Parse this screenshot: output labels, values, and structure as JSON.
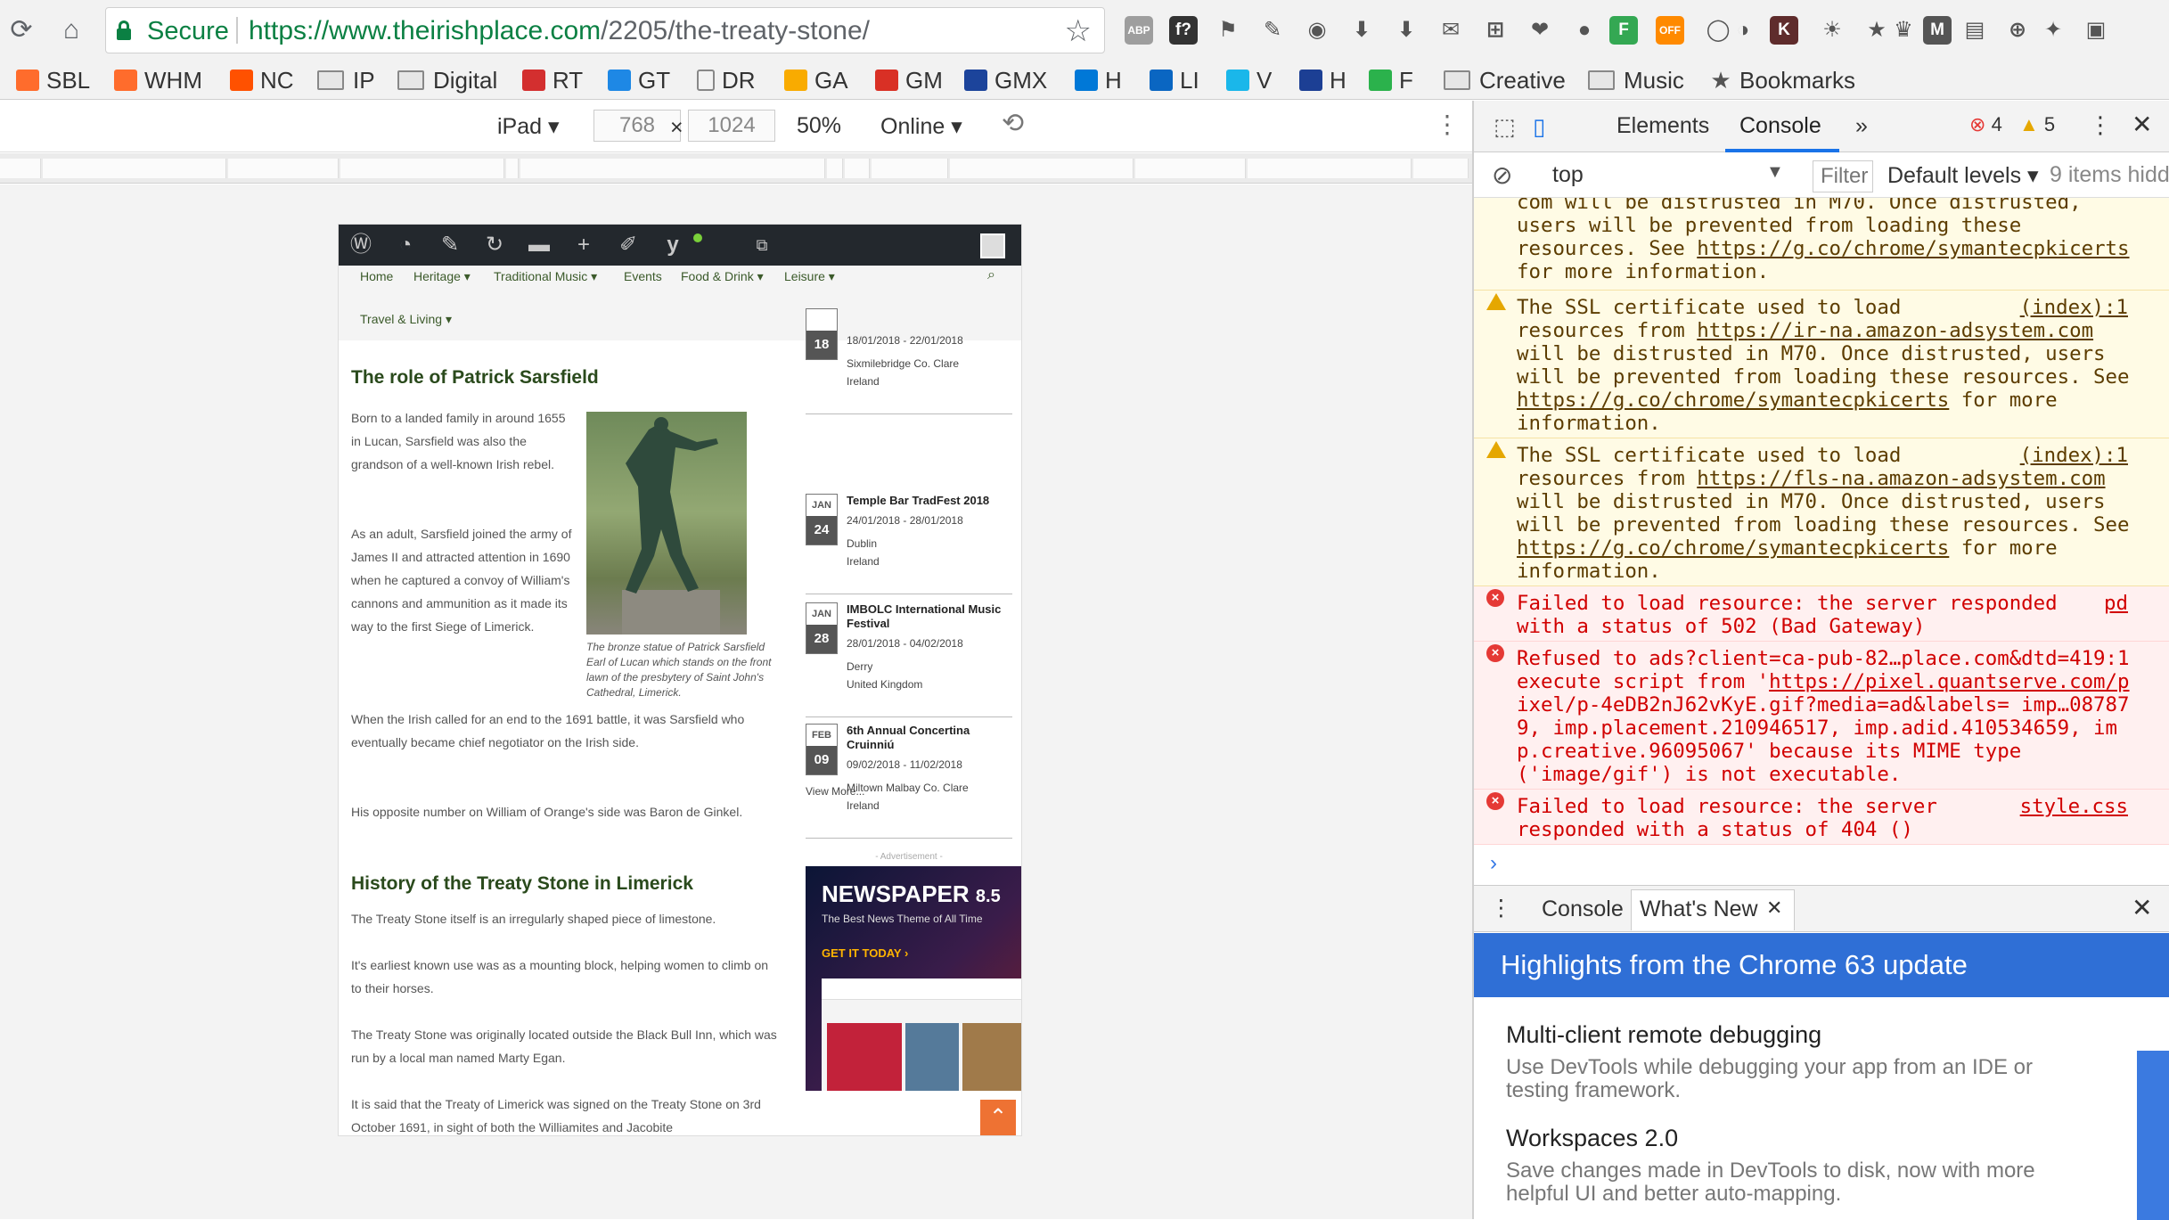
{
  "browser": {
    "secure_label": "Secure",
    "url_domain": "https://www.theirishplace.com",
    "url_path": "/2205/the-treaty-stone/",
    "extensions": [
      {
        "label": "ABP",
        "color": "#9e9e9e"
      },
      {
        "label": "f?",
        "color": "#333333"
      },
      {
        "label": "F",
        "color": "#34a853"
      },
      {
        "label": "OFF",
        "color": "#ff8a00"
      },
      {
        "label": "K",
        "color": "#5f2c2c"
      },
      {
        "label": "M",
        "color": "#555555"
      }
    ]
  },
  "bookmarks": [
    {
      "label": "SBL",
      "icon": "cpanel-icon",
      "color": "#ff6c2c"
    },
    {
      "label": "WHM",
      "icon": "cpanel-icon",
      "color": "#ff6c2c"
    },
    {
      "label": "NC",
      "icon": "namecheap-icon",
      "color": "#ff5100"
    },
    {
      "label": "IP",
      "icon": "folder-icon",
      "color": "#888888"
    },
    {
      "label": "Digital",
      "icon": "folder-icon",
      "color": "#888888"
    },
    {
      "label": "RT",
      "icon": "robot-icon",
      "color": "#d32f2f"
    },
    {
      "label": "GT",
      "icon": "chart-icon",
      "color": "#1e88e5"
    },
    {
      "label": "DR",
      "icon": "page-icon",
      "color": "#888888"
    },
    {
      "label": "GA",
      "icon": "analytics-icon",
      "color": "#f9ab00"
    },
    {
      "label": "GM",
      "icon": "gmail-icon",
      "color": "#d93025"
    },
    {
      "label": "GMX",
      "icon": "gmx-icon",
      "color": "#1c449b"
    },
    {
      "label": "H",
      "icon": "windows-icon",
      "color": "#0078d7"
    },
    {
      "label": "LI",
      "icon": "linkedin-icon",
      "color": "#0a66c2"
    },
    {
      "label": "V",
      "icon": "vimeo-icon",
      "color": "#1ab7ea"
    },
    {
      "label": "H",
      "icon": "hotel-icon",
      "color": "#1c3f94"
    },
    {
      "label": "F",
      "icon": "feedly-icon",
      "color": "#2bb24c"
    },
    {
      "label": "Creative",
      "icon": "folder-icon",
      "color": "#888888"
    },
    {
      "label": "Music",
      "icon": "folder-icon",
      "color": "#888888"
    },
    {
      "label": "Bookmarks",
      "icon": "star-icon",
      "color": "#555555"
    }
  ],
  "device_toolbar": {
    "device": "iPad",
    "width": "768",
    "height": "1024",
    "zoom": "50%",
    "network": "Online"
  },
  "site": {
    "nav": [
      "Home",
      "Heritage",
      "Traditional Music",
      "Events",
      "Food & Drink",
      "Leisure",
      "Travel & Living"
    ],
    "heading1": "The role of Patrick Sarsfield",
    "paragraphs1": [
      "Born to a landed family in around 1655 in Lucan, Sarsfield was also the grandson of a well-known Irish rebel.",
      "As an adult, Sarsfield joined the army of James II and attracted attention in 1690 when he captured a convoy of William's cannons and ammunition as it made its way to the first Siege of Limerick.",
      "When the Irish called for an end to the 1691 battle, it was Sarsfield who eventually became chief negotiator on the Irish side.",
      "His opposite number on William of Orange's side was Baron de Ginkel."
    ],
    "caption": "The bronze statue of Patrick Sarsfield Earl of Lucan which stands on the front lawn of the presbytery of Saint John's Cathedral, Limerick.",
    "heading2": "History of the Treaty Stone in Limerick",
    "paragraphs2": [
      "The Treaty Stone itself is an irregularly shaped piece of limestone.",
      "It's earliest known use was as a mounting block, helping women to climb on to their horses.",
      "The Treaty Stone was originally located outside the Black Bull Inn, which was run by a local man named Marty Egan.",
      "It is said that the Treaty of Limerick was signed on the Treaty Stone on 3rd October 1691, in sight of both the Williamites and Jacobite"
    ],
    "events": [
      {
        "month": "",
        "day": "18",
        "title": "",
        "dates": "18/01/2018 - 22/01/2018",
        "place": "Sixmilebridge Co. Clare",
        "country": "Ireland"
      },
      {
        "month": "JAN",
        "day": "24",
        "title": "Temple Bar TradFest 2018",
        "dates": "24/01/2018 - 28/01/2018",
        "place": "Dublin",
        "country": "Ireland"
      },
      {
        "month": "JAN",
        "day": "28",
        "title": "IMBOLC International Music Festival",
        "dates": "28/01/2018 - 04/02/2018",
        "place": "Derry",
        "country": "United Kingdom"
      },
      {
        "month": "FEB",
        "day": "09",
        "title": "6th Annual Concertina Cruinniú",
        "dates": "09/02/2018 - 11/02/2018",
        "place": "Miltown Malbay Co. Clare",
        "country": "Ireland"
      }
    ],
    "view_more": "View More...",
    "ad_label": "- Advertisement -",
    "ad_title": "NEWSPAPER",
    "ad_version": "8.5",
    "ad_sub": "The Best News Theme of All Time",
    "ad_cta": "GET IT TODAY ›"
  },
  "devtools": {
    "tabs": [
      "Elements",
      "Console"
    ],
    "error_count": "4",
    "warning_count": "5",
    "context": "top",
    "filter_placeholder": "Filter",
    "levels": "Default levels",
    "hidden": "9 items hidd",
    "messages": [
      {
        "type": "warn",
        "lines": [
          "com will be distrusted in M70. Once distrusted,",
          "users will be prevented from loading these",
          "resources. See https://g.co/chrome/symantecpkicerts",
          "for more information."
        ],
        "src": ""
      },
      {
        "type": "warn",
        "lines": [
          "The SSL certificate used to load",
          "resources from https://ir-na.amazon-adsystem.com",
          "will be distrusted in M70. Once distrusted, users",
          "will be prevented from loading these resources. See",
          "https://g.co/chrome/symantecpkicerts for more",
          "information."
        ],
        "src": "(index):1"
      },
      {
        "type": "warn",
        "lines": [
          "The SSL certificate used to load",
          "resources from https://fls-na.amazon-adsystem.com",
          "will be distrusted in M70. Once distrusted, users",
          "will be prevented from loading these resources. See",
          "https://g.co/chrome/symantecpkicerts for more",
          "information."
        ],
        "src": "(index):1"
      },
      {
        "type": "err",
        "lines": [
          "Failed to load resource: the server responded",
          "with a status of 502 (Bad Gateway)"
        ],
        "src": "pd"
      },
      {
        "type": "err",
        "lines": [
          "Refused to ads?client=ca-pub-82…place.com&dtd=419:1",
          "execute script from 'https://pixel.quantserve.com/p",
          "ixel/p-4eDB2nJ62vKyE.gif?media=ad&labels= imp…08787",
          "9, imp.placement.210946517, imp.adid.410534659, im",
          "p.creative.96095067' because its MIME type",
          "('image/gif') is not executable."
        ],
        "src": ""
      },
      {
        "type": "err",
        "lines": [
          "Failed to load resource: the server",
          "responded with a status of 404 ()"
        ],
        "src": "style.css"
      }
    ],
    "drawer_tabs": [
      "Console",
      "What's New"
    ],
    "whatsnew_title": "Highlights from the Chrome 63 update",
    "whatsnew_items": [
      {
        "title": "Multi-client remote debugging",
        "desc": "Use DevTools while debugging your app from an IDE or testing framework."
      },
      {
        "title": "Workspaces 2.0",
        "desc": "Save changes made in DevTools to disk, now with more helpful UI and better auto-mapping."
      }
    ]
  }
}
